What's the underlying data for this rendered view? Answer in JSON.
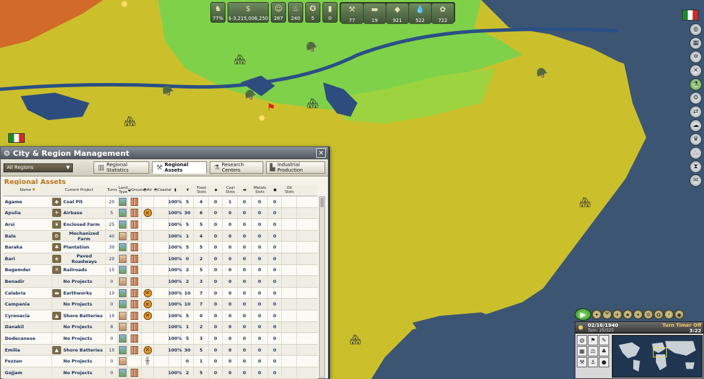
{
  "topbar": {
    "resources": [
      {
        "icon": "soldier-icon",
        "value": "77%"
      },
      {
        "icon": "money-bag-icon",
        "value": "$-3,215,006,250"
      },
      {
        "icon": "population-icon",
        "value": "287"
      },
      {
        "icon": "food-icon",
        "value": "240"
      },
      {
        "icon": "medal-icon",
        "value": "5"
      },
      {
        "icon": "barrel-icon",
        "value": "0"
      }
    ],
    "materials": [
      {
        "icon": "ore-icon",
        "value": "77"
      },
      {
        "icon": "steel-icon",
        "value": "19"
      },
      {
        "icon": "coal-icon",
        "value": "921"
      },
      {
        "icon": "oil-icon",
        "value": "522"
      },
      {
        "icon": "wheat-icon",
        "value": "722"
      }
    ]
  },
  "panel": {
    "title": "City & Region Management",
    "close": "✕",
    "region_select": "All Regions",
    "tabs": [
      {
        "label": "Regional Statistics",
        "icon": "chart-icon"
      },
      {
        "label": "Regional Assets",
        "icon": "tools-icon"
      },
      {
        "label": "Research Centers",
        "icon": "flask-icon"
      },
      {
        "label": "Industrial Production",
        "icon": "factory-icon"
      }
    ],
    "section_title": "Regional Assets",
    "columns": {
      "name": "Name",
      "project": "Current Project",
      "turns": "Turns",
      "land": "Land Type",
      "ground": "Ground",
      "air": "Air",
      "coastal": "Coastal",
      "eff": "",
      "pop": "",
      "food": "Food Slots",
      "foodv": "",
      "coal": "Coal Slots",
      "coalv": "",
      "metals": "Metals Slots",
      "metalsv": "",
      "oil": "Oil Slots"
    },
    "rows": [
      {
        "name": "Agame",
        "project": "Coal Pit",
        "turns": "20",
        "land": "green",
        "ground": true,
        "air": "",
        "pct": "100%",
        "a": "5",
        "b": "4",
        "c": "0",
        "d": "1",
        "e": "0",
        "f": "0",
        "g": "0"
      },
      {
        "name": "Apulia",
        "project": "Airbase",
        "turns": "5",
        "land": "green",
        "ground": true,
        "air": "x",
        "pct": "100%",
        "a": "30",
        "b": "6",
        "c": "0",
        "d": "0",
        "e": "0",
        "f": "0",
        "g": "0"
      },
      {
        "name": "Arsi",
        "project": "Enclosed Farm",
        "turns": "25",
        "land": "green",
        "ground": true,
        "air": "",
        "pct": "100%",
        "a": "5",
        "b": "5",
        "c": "0",
        "d": "0",
        "e": "0",
        "f": "0",
        "g": "0"
      },
      {
        "name": "Bale",
        "project": "Mechanized Farm",
        "turns": "40",
        "land": "desert",
        "ground": true,
        "air": "",
        "pct": "100%",
        "a": "1",
        "b": "4",
        "c": "0",
        "d": "0",
        "e": "0",
        "f": "0",
        "g": "0"
      },
      {
        "name": "Baraka",
        "project": "Plantation",
        "turns": "30",
        "land": "green",
        "ground": true,
        "air": "",
        "pct": "100%",
        "a": "5",
        "b": "5",
        "c": "0",
        "d": "0",
        "e": "0",
        "f": "0",
        "g": "0"
      },
      {
        "name": "Bari",
        "project": "Paved Roadways",
        "turns": "20",
        "land": "desert",
        "ground": true,
        "air": "",
        "pct": "100%",
        "a": "0",
        "b": "2",
        "c": "0",
        "d": "0",
        "e": "0",
        "f": "0",
        "g": "0"
      },
      {
        "name": "Begemder",
        "project": "Railroads",
        "turns": "15",
        "land": "green",
        "ground": true,
        "air": "",
        "pct": "100%",
        "a": "2",
        "b": "5",
        "c": "0",
        "d": "0",
        "e": "0",
        "f": "0",
        "g": "0"
      },
      {
        "name": "Benadir",
        "project": "No Projects",
        "turns": "0",
        "land": "desert",
        "ground": true,
        "air": "",
        "pct": "100%",
        "a": "2",
        "b": "3",
        "c": "0",
        "d": "0",
        "e": "0",
        "f": "0",
        "g": "0"
      },
      {
        "name": "Calabria",
        "project": "Earthworks",
        "turns": "10",
        "land": "green",
        "ground": true,
        "air": "x",
        "pct": "100%",
        "a": "10",
        "b": "7",
        "c": "0",
        "d": "0",
        "e": "0",
        "f": "0",
        "g": "0"
      },
      {
        "name": "Campania",
        "project": "No Projects",
        "turns": "0",
        "land": "green",
        "ground": true,
        "air": "x",
        "pct": "100%",
        "a": "10",
        "b": "7",
        "c": "0",
        "d": "0",
        "e": "0",
        "f": "0",
        "g": "0"
      },
      {
        "name": "Cyrenacia",
        "project": "Shore Batteries",
        "turns": "10",
        "land": "desert",
        "ground": true,
        "air": "x",
        "pct": "100%",
        "a": "5",
        "b": "0",
        "c": "0",
        "d": "0",
        "e": "0",
        "f": "0",
        "g": "0"
      },
      {
        "name": "Danakil",
        "project": "No Projects",
        "turns": "8",
        "land": "desert",
        "ground": true,
        "air": "",
        "pct": "100%",
        "a": "1",
        "b": "2",
        "c": "0",
        "d": "0",
        "e": "0",
        "f": "0",
        "g": "0"
      },
      {
        "name": "Dodecanese",
        "project": "No Projects",
        "turns": "0",
        "land": "green",
        "ground": true,
        "air": "",
        "pct": "100%",
        "a": "5",
        "b": "3",
        "c": "0",
        "d": "0",
        "e": "0",
        "f": "0",
        "g": "0"
      },
      {
        "name": "Emilia",
        "project": "Shore Batteries",
        "turns": "10",
        "land": "green",
        "ground": true,
        "air": "x",
        "pct": "100%",
        "a": "30",
        "b": "5",
        "c": "0",
        "d": "0",
        "e": "0",
        "f": "0",
        "g": "0"
      },
      {
        "name": "Fezzan",
        "project": "No Projects",
        "turns": "0",
        "land": "desert",
        "ground": false,
        "air": "rail",
        "pct": "",
        "a": "0",
        "b": "1",
        "c": "0",
        "d": "0",
        "e": "0",
        "f": "0",
        "g": "0"
      },
      {
        "name": "Gojjam",
        "project": "No Projects",
        "turns": "0",
        "land": "green",
        "ground": true,
        "air": "",
        "pct": "100%",
        "a": "2",
        "b": "5",
        "c": "0",
        "d": "0",
        "e": "0",
        "f": "0",
        "g": "0"
      }
    ]
  },
  "bottom": {
    "date": "02/16/1940",
    "turn": "Turn: 25/325",
    "timer_label": "Turn Timer Off",
    "timer": "3:22"
  }
}
